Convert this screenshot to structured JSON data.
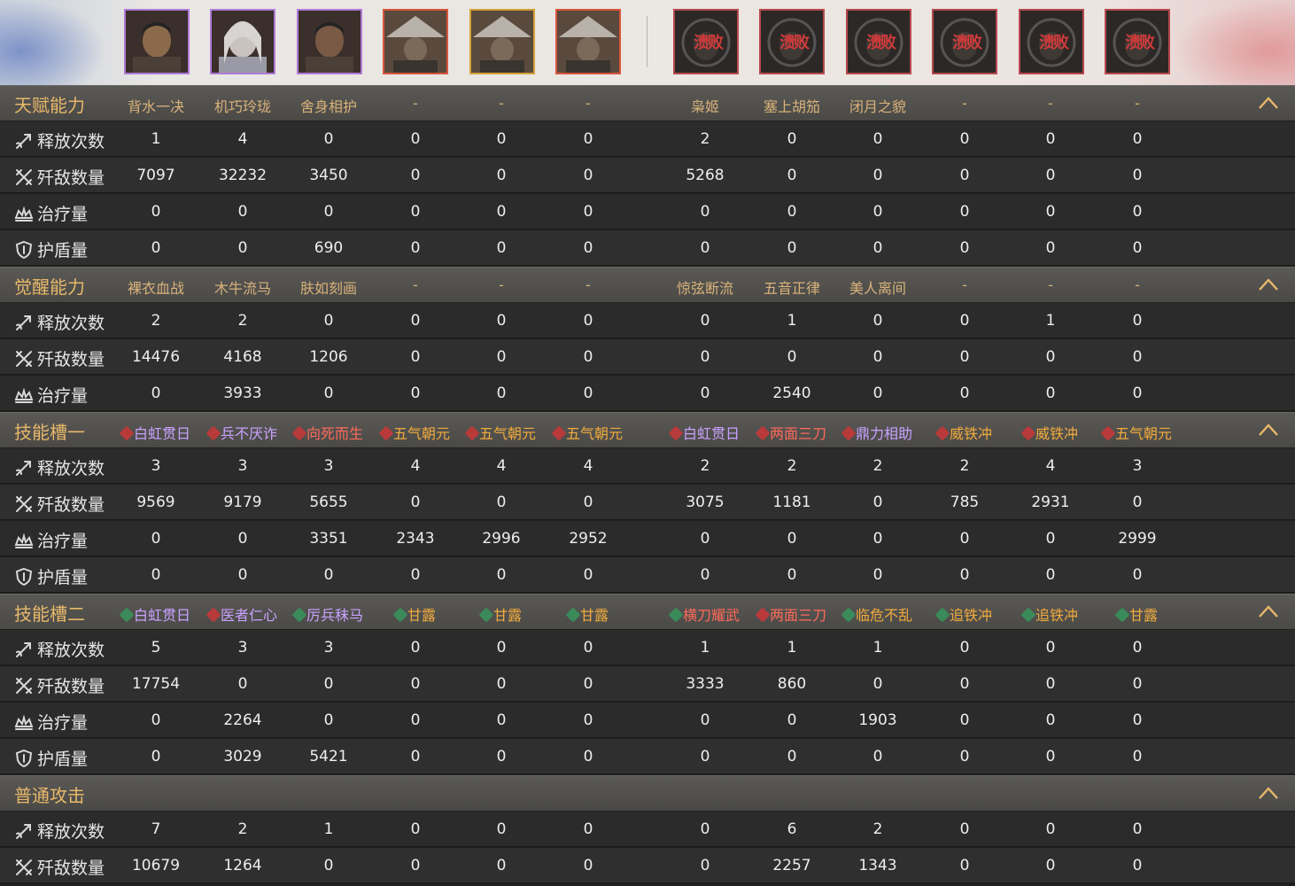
{
  "portraits": {
    "ally": [
      {
        "id": "ally-1",
        "frame": "purple",
        "skin": "#8a6a4a"
      },
      {
        "id": "ally-2",
        "frame": "purple",
        "skin": "#c9c2bf"
      },
      {
        "id": "ally-3",
        "frame": "purple",
        "skin": "#7a5a44"
      },
      {
        "id": "ally-4",
        "frame": "red",
        "skin": "#8e8a86"
      },
      {
        "id": "ally-5",
        "frame": "gold",
        "skin": "#8e8a86"
      },
      {
        "id": "ally-6",
        "frame": "red",
        "skin": "#8e8a86"
      }
    ],
    "enemy": [
      {
        "id": "enemy-1",
        "defeat": "溃败"
      },
      {
        "id": "enemy-2",
        "defeat": "溃败"
      },
      {
        "id": "enemy-3",
        "defeat": "溃败"
      },
      {
        "id": "enemy-4",
        "defeat": "溃败"
      },
      {
        "id": "enemy-5",
        "defeat": "溃败"
      },
      {
        "id": "enemy-6",
        "defeat": "溃败"
      }
    ]
  },
  "colors": {
    "header_text": "#e8b86a",
    "row_text": "#e6e6e6",
    "purple": "#c9a2ff",
    "red": "#ff6a5a",
    "gold": "#f2ab3d"
  },
  "labels": {
    "cast": "释放次数",
    "kill": "歼敌数量",
    "heal": "治疗量",
    "shield": "护盾量"
  },
  "icons": {
    "cast": "sword-icon",
    "kill": "crossed-swords-icon",
    "heal": "heal-crown-icon",
    "shield": "shield-icon",
    "collapse": "chevron-up-icon"
  },
  "sections": [
    {
      "title": "天赋能力",
      "skills": [
        {
          "t": "背水一决"
        },
        {
          "t": "机巧玲珑"
        },
        {
          "t": "舍身相护"
        },
        {
          "t": "-"
        },
        {
          "t": "-"
        },
        {
          "t": "-"
        },
        {
          "t": "枭姬"
        },
        {
          "t": "塞上胡笳"
        },
        {
          "t": "闭月之貌"
        },
        {
          "t": "-"
        },
        {
          "t": "-"
        },
        {
          "t": "-"
        }
      ],
      "rows": [
        {
          "k": "cast",
          "v": [
            "1",
            "4",
            "0",
            "0",
            "0",
            "0",
            "2",
            "0",
            "0",
            "0",
            "0",
            "0"
          ]
        },
        {
          "k": "kill",
          "v": [
            "7097",
            "32232",
            "3450",
            "0",
            "0",
            "0",
            "5268",
            "0",
            "0",
            "0",
            "0",
            "0"
          ]
        },
        {
          "k": "heal",
          "v": [
            "0",
            "0",
            "0",
            "0",
            "0",
            "0",
            "0",
            "0",
            "0",
            "0",
            "0",
            "0"
          ]
        },
        {
          "k": "shield",
          "v": [
            "0",
            "0",
            "690",
            "0",
            "0",
            "0",
            "0",
            "0",
            "0",
            "0",
            "0",
            "0"
          ]
        }
      ]
    },
    {
      "title": "觉醒能力",
      "skills": [
        {
          "t": "裸衣血战"
        },
        {
          "t": "木牛流马"
        },
        {
          "t": "肤如刻画"
        },
        {
          "t": "-"
        },
        {
          "t": "-"
        },
        {
          "t": "-"
        },
        {
          "t": "惊弦断流"
        },
        {
          "t": "五音正律"
        },
        {
          "t": "美人离间"
        },
        {
          "t": "-"
        },
        {
          "t": "-"
        },
        {
          "t": "-"
        }
      ],
      "rows": [
        {
          "k": "cast",
          "v": [
            "2",
            "2",
            "0",
            "0",
            "0",
            "0",
            "0",
            "1",
            "0",
            "0",
            "1",
            "0"
          ]
        },
        {
          "k": "kill",
          "v": [
            "14476",
            "4168",
            "1206",
            "0",
            "0",
            "0",
            "0",
            "0",
            "0",
            "0",
            "0",
            "0"
          ]
        },
        {
          "k": "heal",
          "v": [
            "0",
            "3933",
            "0",
            "0",
            "0",
            "0",
            "0",
            "2540",
            "0",
            "0",
            "0",
            "0"
          ]
        }
      ]
    },
    {
      "title": "技能槽一",
      "skills": [
        {
          "t": "白虹贯日",
          "c": "purple",
          "tag": "r"
        },
        {
          "t": "兵不厌诈",
          "c": "purple",
          "tag": "r"
        },
        {
          "t": "向死而生",
          "c": "red",
          "tag": "r"
        },
        {
          "t": "五气朝元",
          "c": "gold",
          "tag": "r"
        },
        {
          "t": "五气朝元",
          "c": "gold",
          "tag": "r"
        },
        {
          "t": "五气朝元",
          "c": "gold",
          "tag": "r"
        },
        {
          "t": "白虹贯日",
          "c": "purple",
          "tag": "r"
        },
        {
          "t": "两面三刀",
          "c": "red",
          "tag": "r"
        },
        {
          "t": "鼎力相助",
          "c": "purple",
          "tag": "r"
        },
        {
          "t": "威铁冲",
          "c": "gold",
          "tag": "r"
        },
        {
          "t": "威铁冲",
          "c": "gold",
          "tag": "r"
        },
        {
          "t": "五气朝元",
          "c": "gold",
          "tag": "r"
        }
      ],
      "rows": [
        {
          "k": "cast",
          "v": [
            "3",
            "3",
            "3",
            "4",
            "4",
            "4",
            "2",
            "2",
            "2",
            "2",
            "4",
            "3"
          ]
        },
        {
          "k": "kill",
          "v": [
            "9569",
            "9179",
            "5655",
            "0",
            "0",
            "0",
            "3075",
            "1181",
            "0",
            "785",
            "2931",
            "0"
          ]
        },
        {
          "k": "heal",
          "v": [
            "0",
            "0",
            "3351",
            "2343",
            "2996",
            "2952",
            "0",
            "0",
            "0",
            "0",
            "0",
            "2999"
          ]
        },
        {
          "k": "shield",
          "v": [
            "0",
            "0",
            "0",
            "0",
            "0",
            "0",
            "0",
            "0",
            "0",
            "0",
            "0",
            "0"
          ]
        }
      ]
    },
    {
      "title": "技能槽二",
      "skills": [
        {
          "t": "白虹贯日",
          "c": "purple",
          "tag": "g"
        },
        {
          "t": "医者仁心",
          "c": "purple",
          "tag": "r"
        },
        {
          "t": "厉兵秣马",
          "c": "purple",
          "tag": "g"
        },
        {
          "t": "甘露",
          "c": "gold",
          "tag": "g"
        },
        {
          "t": "甘露",
          "c": "gold",
          "tag": "g"
        },
        {
          "t": "甘露",
          "c": "gold",
          "tag": "g"
        },
        {
          "t": "横刀耀武",
          "c": "red",
          "tag": "g"
        },
        {
          "t": "两面三刀",
          "c": "red",
          "tag": "r"
        },
        {
          "t": "临危不乱",
          "c": "gold",
          "tag": "g"
        },
        {
          "t": "追铁冲",
          "c": "gold",
          "tag": "g"
        },
        {
          "t": "追铁冲",
          "c": "gold",
          "tag": "g"
        },
        {
          "t": "甘露",
          "c": "gold",
          "tag": "g"
        }
      ],
      "rows": [
        {
          "k": "cast",
          "v": [
            "5",
            "3",
            "3",
            "0",
            "0",
            "0",
            "1",
            "1",
            "1",
            "0",
            "0",
            "0"
          ]
        },
        {
          "k": "kill",
          "v": [
            "17754",
            "0",
            "0",
            "0",
            "0",
            "0",
            "3333",
            "860",
            "0",
            "0",
            "0",
            "0"
          ]
        },
        {
          "k": "heal",
          "v": [
            "0",
            "2264",
            "0",
            "0",
            "0",
            "0",
            "0",
            "0",
            "1903",
            "0",
            "0",
            "0"
          ]
        },
        {
          "k": "shield",
          "v": [
            "0",
            "3029",
            "5421",
            "0",
            "0",
            "0",
            "0",
            "0",
            "0",
            "0",
            "0",
            "0"
          ]
        }
      ]
    },
    {
      "title": "普通攻击",
      "skills": [],
      "rows": [
        {
          "k": "cast",
          "v": [
            "7",
            "2",
            "1",
            "0",
            "0",
            "0",
            "0",
            "6",
            "2",
            "0",
            "0",
            "0"
          ]
        },
        {
          "k": "kill",
          "v": [
            "10679",
            "1264",
            "0",
            "0",
            "0",
            "0",
            "0",
            "2257",
            "1343",
            "0",
            "0",
            "0"
          ]
        }
      ]
    }
  ]
}
